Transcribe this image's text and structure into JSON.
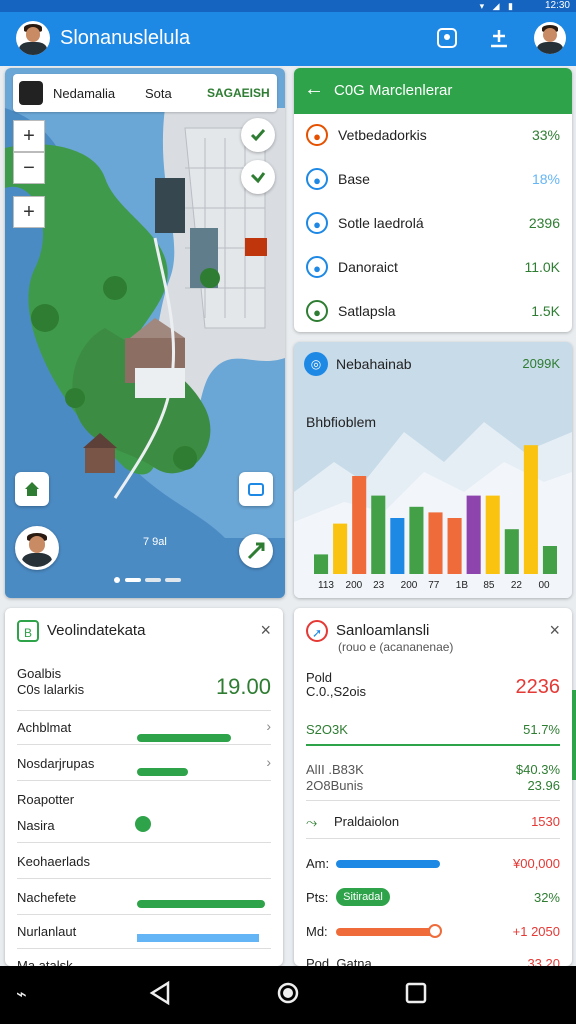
{
  "status": {
    "time": "12:30",
    "signals": "▾ ◢ ▮"
  },
  "appbar": {
    "title": "Slonanuslelula"
  },
  "map": {
    "tabs": [
      "Nedamalia",
      "Sota",
      "SAGAEISH"
    ],
    "zoom_in": "+",
    "zoom_out": "−",
    "zoom_extra": "+",
    "coords": "7 9al"
  },
  "stats": {
    "title": "C0G Marclenlerar",
    "rows": [
      {
        "label": "Vetbedadorkis",
        "value": "33%",
        "icon": "clock-icon",
        "color": "#e65100",
        "val_color": "#2e7d32"
      },
      {
        "label": "Base",
        "value": "18%",
        "icon": "building-icon",
        "color": "#1e88e5",
        "val_color": "#64b5f6"
      },
      {
        "label": "Sotle laedrolá",
        "value": "2396",
        "icon": "target-icon",
        "color": "#1e88e5",
        "val_color": "#2e7d32"
      },
      {
        "label": "Danoraict",
        "value": "11.0K",
        "icon": "truck-icon",
        "color": "#1e88e5",
        "val_color": "#2e7d32"
      },
      {
        "label": "Satlapsla",
        "value": "1.5K",
        "icon": "trash-icon",
        "color": "#2e7d32",
        "val_color": "#2e7d32"
      }
    ]
  },
  "chart_data": {
    "type": "bar",
    "title": "Nebahainab",
    "subtitle": "Bhbfioblem",
    "header_value": "2099K",
    "categories": [
      "113",
      "200",
      "23",
      "200",
      "77",
      "1B",
      "85",
      "22",
      "00"
    ],
    "values": [
      [
        12,
        28,
        34
      ],
      [
        0,
        38,
        0
      ],
      [
        0,
        62,
        0
      ],
      [
        0,
        50,
        30
      ],
      [
        0,
        42,
        0
      ],
      [
        0,
        38,
        0
      ],
      [
        0,
        52,
        30
      ],
      [
        0,
        52,
        0
      ],
      [
        0,
        90,
        25
      ]
    ],
    "series_colors": [
      "#43a047",
      "#ef6c3a",
      "#1e88e5",
      "#f9c30f",
      "#8e44ad"
    ],
    "bars": [
      {
        "x": "113",
        "value": 14,
        "color": "#43a047"
      },
      {
        "x": "200",
        "value": 36,
        "color": "#f9c30f"
      },
      {
        "x": "23",
        "value": 70,
        "color": "#ef6c3a"
      },
      {
        "x": "200",
        "value": 56,
        "color": "#43a047"
      },
      {
        "x": "200",
        "value": 40,
        "color": "#1e88e5"
      },
      {
        "x": "77",
        "value": 48,
        "color": "#43a047"
      },
      {
        "x": "77",
        "value": 44,
        "color": "#ef6c3a"
      },
      {
        "x": "1B",
        "value": 40,
        "color": "#ef6c3a"
      },
      {
        "x": "1B",
        "value": 56,
        "color": "#8e44ad"
      },
      {
        "x": "85",
        "value": 56,
        "color": "#f9c30f"
      },
      {
        "x": "85",
        "value": 32,
        "color": "#43a047"
      },
      {
        "x": "22",
        "value": 92,
        "color": "#f9c30f"
      },
      {
        "x": "22",
        "value": 20,
        "color": "#43a047"
      }
    ],
    "ylim": [
      0,
      100
    ]
  },
  "panel_left": {
    "title": "Veolindatekata",
    "l1": "Goalbis",
    "l2": "C0s lalarkis",
    "value": "19.00",
    "rows": [
      {
        "label": "Achblmat",
        "progress": 0.55
      },
      {
        "label": "Nosdarjrupas",
        "progress": 0.3
      }
    ],
    "r3": "Roapotter",
    "r4": "Nasira",
    "r5": "Keohaerlads",
    "r6": "Nachefete",
    "r7": "Nurlanlaut",
    "r8": "Ma atalsk"
  },
  "panel_right": {
    "title": "Sanloamlansli",
    "subtitle": "(rouo e (acananenae)",
    "l1": "Pold",
    "l2": "C.0.,S2ois",
    "value": "2236",
    "s1": "S2O3K",
    "s1v": "51.7%",
    "s2a": "AlII .B83K",
    "s2b": "2O8Bunis",
    "s2v": "$40.3%",
    "s2v2": "23.96",
    "s3": "Praldaiolon",
    "s3v": "1530",
    "b1": "Am:",
    "b1v": "¥00,000",
    "b2": "Pts:",
    "b2v": "32%",
    "b2pill": "Sitiradal",
    "b3": "Md:",
    "b3v": "+1 2050",
    "b4": "Pod. Gatna",
    "b4v": "33 20"
  },
  "colors": {
    "primary": "#1e88e5",
    "green": "#2ea34a",
    "red": "#e53935"
  }
}
